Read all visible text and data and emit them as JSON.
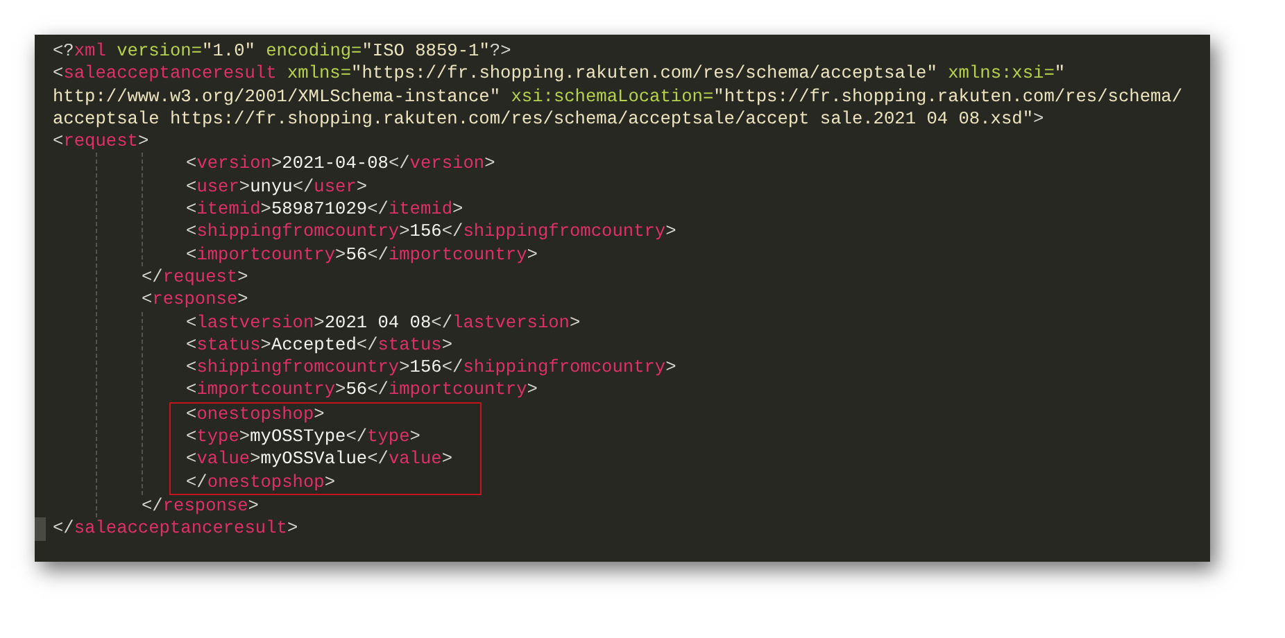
{
  "editor": {
    "lines": [
      {
        "tokens": [
          {
            "kind": "bracket",
            "text": "<?"
          },
          {
            "kind": "tag",
            "text": "xml"
          },
          {
            "kind": "attr",
            "text": " version="
          },
          {
            "kind": "string",
            "text": "\"1.0\""
          },
          {
            "kind": "attr",
            "text": " encoding="
          },
          {
            "kind": "string",
            "text": "\"ISO 8859-1\""
          },
          {
            "kind": "bracket",
            "text": "?>"
          }
        ]
      },
      {
        "tokens": [
          {
            "kind": "bracket",
            "text": "<"
          },
          {
            "kind": "tag",
            "text": "saleacceptanceresult"
          },
          {
            "kind": "attr",
            "text": " xmlns="
          },
          {
            "kind": "string",
            "text": "\"https://fr.shopping.rakuten.com/res/schema/acceptsale\""
          },
          {
            "kind": "attr",
            "text": " xmlns:xsi="
          },
          {
            "kind": "string",
            "text": "\""
          }
        ]
      },
      {
        "tokens": [
          {
            "kind": "string",
            "text": "http://www.w3.org/2001/XMLSchema-instance\""
          },
          {
            "kind": "attr",
            "text": " xsi:schemaLocation="
          },
          {
            "kind": "string",
            "text": "\"https://fr.shopping.rakuten.com/res/schema/"
          }
        ]
      },
      {
        "tokens": [
          {
            "kind": "string",
            "text": "acceptsale https://fr.shopping.rakuten.com/res/schema/acceptsale/accept sale.2021 04 08.xsd\""
          },
          {
            "kind": "bracket",
            "text": ">"
          }
        ]
      },
      {
        "tokens": [
          {
            "kind": "bracket",
            "text": "<"
          },
          {
            "kind": "tag",
            "text": "request"
          },
          {
            "kind": "bracket",
            "text": ">"
          }
        ]
      },
      {
        "kind": "indent",
        "children": [
          {
            "kind": "indent",
            "children": [
              {
                "tokens": [
                  {
                    "kind": "bracket",
                    "text": "<"
                  },
                  {
                    "kind": "tag",
                    "text": "version"
                  },
                  {
                    "kind": "bracket",
                    "text": ">"
                  },
                  {
                    "kind": "text",
                    "text": "2021-04-08"
                  },
                  {
                    "kind": "bracket",
                    "text": "</"
                  },
                  {
                    "kind": "tag",
                    "text": "version"
                  },
                  {
                    "kind": "bracket",
                    "text": ">"
                  }
                ]
              },
              {
                "tokens": [
                  {
                    "kind": "bracket",
                    "text": "<"
                  },
                  {
                    "kind": "tag",
                    "text": "user"
                  },
                  {
                    "kind": "bracket",
                    "text": ">"
                  },
                  {
                    "kind": "text",
                    "text": "unyu"
                  },
                  {
                    "kind": "bracket",
                    "text": "</"
                  },
                  {
                    "kind": "tag",
                    "text": "user"
                  },
                  {
                    "kind": "bracket",
                    "text": ">"
                  }
                ]
              },
              {
                "tokens": [
                  {
                    "kind": "bracket",
                    "text": "<"
                  },
                  {
                    "kind": "tag",
                    "text": "itemid"
                  },
                  {
                    "kind": "bracket",
                    "text": ">"
                  },
                  {
                    "kind": "text",
                    "text": "589871029"
                  },
                  {
                    "kind": "bracket",
                    "text": "</"
                  },
                  {
                    "kind": "tag",
                    "text": "itemid"
                  },
                  {
                    "kind": "bracket",
                    "text": ">"
                  }
                ]
              },
              {
                "tokens": [
                  {
                    "kind": "bracket",
                    "text": "<"
                  },
                  {
                    "kind": "tag",
                    "text": "shippingfromcountry"
                  },
                  {
                    "kind": "bracket",
                    "text": ">"
                  },
                  {
                    "kind": "text",
                    "text": "156"
                  },
                  {
                    "kind": "bracket",
                    "text": "</"
                  },
                  {
                    "kind": "tag",
                    "text": "shippingfromcountry"
                  },
                  {
                    "kind": "bracket",
                    "text": ">"
                  }
                ]
              },
              {
                "tokens": [
                  {
                    "kind": "bracket",
                    "text": "<"
                  },
                  {
                    "kind": "tag",
                    "text": "importcountry"
                  },
                  {
                    "kind": "bracket",
                    "text": ">"
                  },
                  {
                    "kind": "text",
                    "text": "56"
                  },
                  {
                    "kind": "bracket",
                    "text": "</"
                  },
                  {
                    "kind": "tag",
                    "text": "importcountry"
                  },
                  {
                    "kind": "bracket",
                    "text": ">"
                  }
                ]
              }
            ]
          },
          {
            "tokens": [
              {
                "kind": "bracket",
                "text": "</"
              },
              {
                "kind": "tag",
                "text": "request"
              },
              {
                "kind": "bracket",
                "text": ">"
              }
            ]
          },
          {
            "tokens": [
              {
                "kind": "bracket",
                "text": "<"
              },
              {
                "kind": "tag",
                "text": "response"
              },
              {
                "kind": "bracket",
                "text": ">"
              }
            ]
          },
          {
            "kind": "indent",
            "children": [
              {
                "tokens": [
                  {
                    "kind": "bracket",
                    "text": "<"
                  },
                  {
                    "kind": "tag",
                    "text": "lastversion"
                  },
                  {
                    "kind": "bracket",
                    "text": ">"
                  },
                  {
                    "kind": "text",
                    "text": "2021 04 08"
                  },
                  {
                    "kind": "bracket",
                    "text": "</"
                  },
                  {
                    "kind": "tag",
                    "text": "lastversion"
                  },
                  {
                    "kind": "bracket",
                    "text": ">"
                  }
                ]
              },
              {
                "tokens": [
                  {
                    "kind": "bracket",
                    "text": "<"
                  },
                  {
                    "kind": "tag",
                    "text": "status"
                  },
                  {
                    "kind": "bracket",
                    "text": ">"
                  },
                  {
                    "kind": "text",
                    "text": "Accepted"
                  },
                  {
                    "kind": "bracket",
                    "text": "</"
                  },
                  {
                    "kind": "tag",
                    "text": "status"
                  },
                  {
                    "kind": "bracket",
                    "text": ">"
                  }
                ]
              },
              {
                "tokens": [
                  {
                    "kind": "bracket",
                    "text": "<"
                  },
                  {
                    "kind": "tag",
                    "text": "shippingfromcountry"
                  },
                  {
                    "kind": "bracket",
                    "text": ">"
                  },
                  {
                    "kind": "text",
                    "text": "156"
                  },
                  {
                    "kind": "bracket",
                    "text": "</"
                  },
                  {
                    "kind": "tag",
                    "text": "shippingfromcountry"
                  },
                  {
                    "kind": "bracket",
                    "text": ">"
                  }
                ]
              },
              {
                "tokens": [
                  {
                    "kind": "bracket",
                    "text": "<"
                  },
                  {
                    "kind": "tag",
                    "text": "importcountry"
                  },
                  {
                    "kind": "bracket",
                    "text": ">"
                  },
                  {
                    "kind": "text",
                    "text": "56"
                  },
                  {
                    "kind": "bracket",
                    "text": "</"
                  },
                  {
                    "kind": "tag",
                    "text": "importcountry"
                  },
                  {
                    "kind": "bracket",
                    "text": ">"
                  }
                ]
              },
              {
                "kind": "highlight",
                "children": [
                  {
                    "tokens": [
                      {
                        "kind": "bracket",
                        "text": "<"
                      },
                      {
                        "kind": "tag",
                        "text": "onestopshop"
                      },
                      {
                        "kind": "bracket",
                        "text": ">"
                      }
                    ]
                  },
                  {
                    "tokens": [
                      {
                        "kind": "bracket",
                        "text": "<"
                      },
                      {
                        "kind": "tag",
                        "text": "type"
                      },
                      {
                        "kind": "bracket",
                        "text": ">"
                      },
                      {
                        "kind": "text",
                        "text": "myOSSType"
                      },
                      {
                        "kind": "bracket",
                        "text": "</"
                      },
                      {
                        "kind": "tag",
                        "text": "type"
                      },
                      {
                        "kind": "bracket",
                        "text": ">"
                      }
                    ]
                  },
                  {
                    "tokens": [
                      {
                        "kind": "bracket",
                        "text": "<"
                      },
                      {
                        "kind": "tag",
                        "text": "value"
                      },
                      {
                        "kind": "bracket",
                        "text": ">"
                      },
                      {
                        "kind": "text",
                        "text": "myOSSValue"
                      },
                      {
                        "kind": "bracket",
                        "text": "</"
                      },
                      {
                        "kind": "tag",
                        "text": "value"
                      },
                      {
                        "kind": "bracket",
                        "text": ">"
                      }
                    ]
                  },
                  {
                    "tokens": [
                      {
                        "kind": "bracket",
                        "text": "</"
                      },
                      {
                        "kind": "tag",
                        "text": "onestopshop"
                      },
                      {
                        "kind": "bracket",
                        "text": ">"
                      }
                    ]
                  }
                ]
              }
            ]
          },
          {
            "tokens": [
              {
                "kind": "bracket",
                "text": "</"
              },
              {
                "kind": "tag",
                "text": "response"
              },
              {
                "kind": "bracket",
                "text": ">"
              }
            ]
          }
        ]
      },
      {
        "current": true,
        "tokens": [
          {
            "kind": "bracket",
            "text": "</"
          },
          {
            "kind": "tag",
            "text": "saleacceptanceresult"
          },
          {
            "kind": "bracket",
            "text": ">"
          }
        ]
      }
    ]
  }
}
